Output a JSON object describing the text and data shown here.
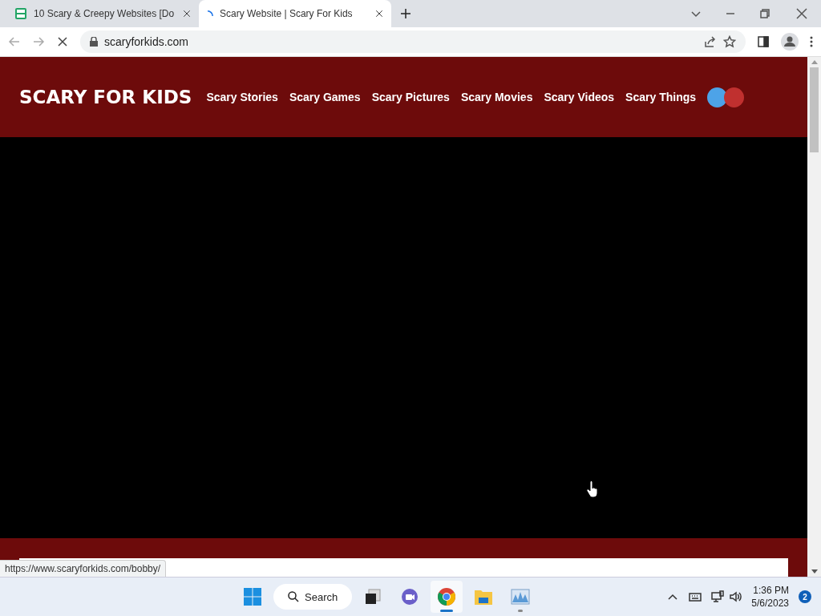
{
  "browser": {
    "tabs": [
      {
        "title": "10 Scary & Creepy Websites [Do",
        "selected": false,
        "loading": false
      },
      {
        "title": "Scary Website | Scary For Kids",
        "selected": true,
        "loading": true
      }
    ],
    "address": "scaryforkids.com",
    "status_url": "https://www.scaryforkids.com/bobby/"
  },
  "site": {
    "logo": "SCARY FOR KIDS",
    "nav": [
      "Scary Stories",
      "Scary Games",
      "Scary Pictures",
      "Scary Movies",
      "Scary Videos",
      "Scary Things"
    ],
    "theme_dots": [
      {
        "color": "#4da3e8"
      },
      {
        "color": "#c0302f"
      }
    ]
  },
  "taskbar": {
    "search": "Search",
    "apps": [
      {
        "kind": "taskview",
        "selected": false,
        "running": false
      },
      {
        "kind": "chat",
        "selected": false,
        "running": false
      },
      {
        "kind": "chrome",
        "selected": true,
        "running": true
      },
      {
        "kind": "files",
        "selected": false,
        "running": false
      },
      {
        "kind": "monitor",
        "selected": false,
        "running": true
      }
    ],
    "time": "1:36 PM",
    "date": "5/6/2023",
    "notifications": "2"
  }
}
